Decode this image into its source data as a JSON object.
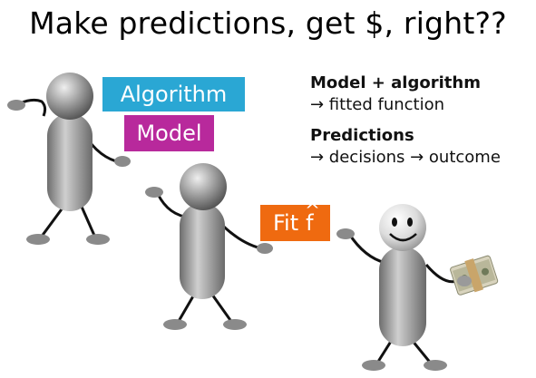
{
  "title": "Make predictions, get $, right??",
  "labels": {
    "algorithm": "Algorithm",
    "model": "Model",
    "fit": "Fit",
    "fit_hat": "f",
    "hat_glyph": "^"
  },
  "notes": {
    "line1_head": "Model + algorithm",
    "line1_body": "→ fitted function",
    "line2_head": "Predictions",
    "line2_body": "→ decisions → outcome"
  },
  "colors": {
    "algorithm": "#2aa7d4",
    "model": "#b8299c",
    "fit": "#ef6a10",
    "figure_gray": "#8a8a8a"
  },
  "icons": [
    "stick-figure",
    "smiley-face",
    "money-stack"
  ]
}
